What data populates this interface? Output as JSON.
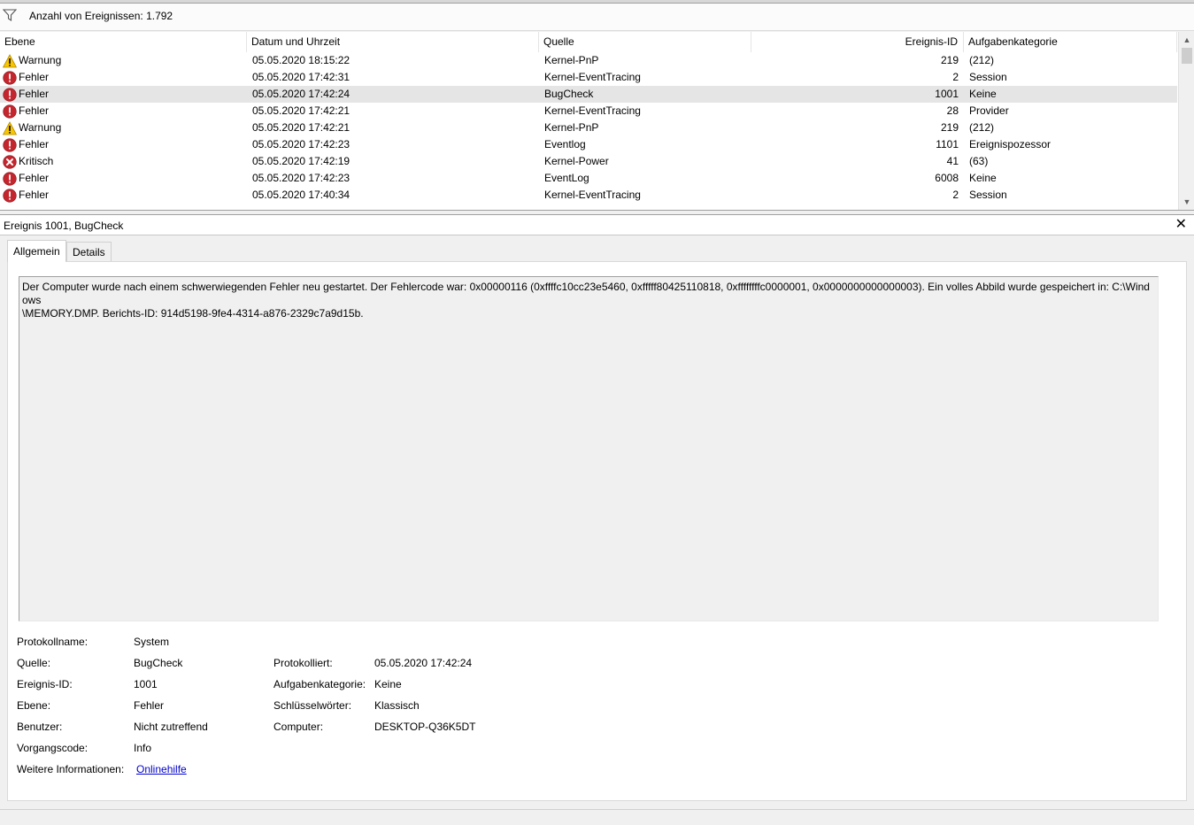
{
  "filter": {
    "count_text": "Anzahl von Ereignissen: 1.792",
    "icon": "filter-icon"
  },
  "columns": {
    "level": "Ebene",
    "date": "Datum und Uhrzeit",
    "source": "Quelle",
    "event_id": "Ereignis-ID",
    "category": "Aufgabenkategorie"
  },
  "events": [
    {
      "level": "Warnung",
      "icon": "warning-icon",
      "date": "05.05.2020 18:15:22",
      "source": "Kernel-PnP",
      "id": "219",
      "category": "(212)"
    },
    {
      "level": "Fehler",
      "icon": "error-icon",
      "date": "05.05.2020 17:42:31",
      "source": "Kernel-EventTracing",
      "id": "2",
      "category": "Session"
    },
    {
      "level": "Fehler",
      "icon": "error-icon",
      "date": "05.05.2020 17:42:24",
      "source": "BugCheck",
      "id": "1001",
      "category": "Keine",
      "selected": true
    },
    {
      "level": "Fehler",
      "icon": "error-icon",
      "date": "05.05.2020 17:42:21",
      "source": "Kernel-EventTracing",
      "id": "28",
      "category": "Provider"
    },
    {
      "level": "Warnung",
      "icon": "warning-icon",
      "date": "05.05.2020 17:42:21",
      "source": "Kernel-PnP",
      "id": "219",
      "category": "(212)"
    },
    {
      "level": "Fehler",
      "icon": "error-icon",
      "date": "05.05.2020 17:42:23",
      "source": "Eventlog",
      "id": "1101",
      "category": "Ereignispozessor"
    },
    {
      "level": "Kritisch",
      "icon": "critical-icon",
      "date": "05.05.2020 17:42:19",
      "source": "Kernel-Power",
      "id": "41",
      "category": "(63)"
    },
    {
      "level": "Fehler",
      "icon": "error-icon",
      "date": "05.05.2020 17:42:23",
      "source": "EventLog",
      "id": "6008",
      "category": "Keine"
    },
    {
      "level": "Fehler",
      "icon": "error-icon",
      "date": "05.05.2020 17:40:34",
      "source": "Kernel-EventTracing",
      "id": "2",
      "category": "Session"
    }
  ],
  "detail": {
    "title": "Ereignis 1001, BugCheck",
    "close": "✕",
    "tabs": [
      "Allgemein",
      "Details"
    ],
    "description": "Der Computer wurde nach einem schwerwiegenden Fehler neu gestartet. Der Fehlercode war: 0x00000116 (0xffffc10cc23e5460, 0xfffff80425110818, 0xffffffffc0000001, 0x0000000000000003). Ein volles Abbild wurde gespeichert in: C:\\Windows\n\\MEMORY.DMP. Berichts-ID: 914d5198-9fe4-4314-a876-2329c7a9d15b.",
    "props": {
      "log_name_label": "Protokollname:",
      "log_name": "System",
      "source_label": "Quelle:",
      "source": "BugCheck",
      "logged_label": "Protokolliert:",
      "logged": "05.05.2020 17:42:24",
      "event_id_label": "Ereignis-ID:",
      "event_id": "1001",
      "task_cat_label": "Aufgabenkategorie:",
      "task_cat": "Keine",
      "level_label": "Ebene:",
      "level": "Fehler",
      "keywords_label": "Schlüsselwörter:",
      "keywords": "Klassisch",
      "user_label": "Benutzer:",
      "user": "Nicht zutreffend",
      "computer_label": "Computer:",
      "computer": "DESKTOP-Q36K5DT",
      "opcode_label": "Vorgangscode:",
      "opcode": "Info",
      "more_info_label": "Weitere Informationen:",
      "more_info_link": "Onlinehilfe"
    }
  }
}
